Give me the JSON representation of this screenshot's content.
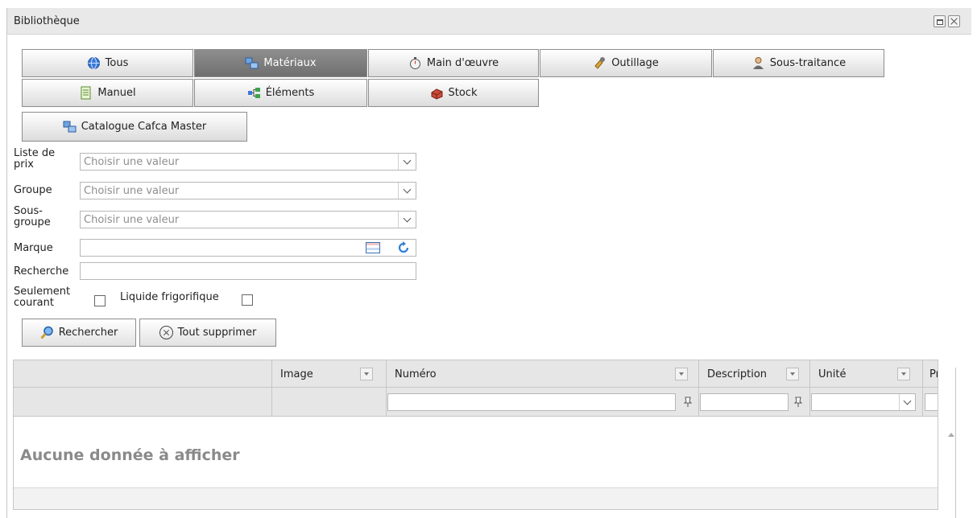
{
  "window": {
    "title": "Bibliothèque"
  },
  "tabs": [
    {
      "label": "Tous",
      "icon": "globe-icon"
    },
    {
      "label": "Matériaux",
      "icon": "materials-icon",
      "active": true
    },
    {
      "label": "Main d'œuvre",
      "icon": "stopwatch-icon"
    },
    {
      "label": "Outillage",
      "icon": "tools-icon"
    },
    {
      "label": "Sous-traitance",
      "icon": "person-icon"
    },
    {
      "label": "Manuel",
      "icon": "manual-icon"
    },
    {
      "label": "Éléments",
      "icon": "elements-icon"
    },
    {
      "label": "Stock",
      "icon": "stock-icon"
    },
    {
      "label": "Catalogue Cafca Master",
      "icon": "catalogue-icon"
    }
  ],
  "filters": {
    "liste_de_prix": {
      "label_line1": "Liste de",
      "label_line2": "prix",
      "placeholder": "Choisir une valeur"
    },
    "groupe": {
      "label": "Groupe",
      "placeholder": "Choisir une valeur"
    },
    "sous_groupe": {
      "label_line1": "Sous-",
      "label_line2": "groupe",
      "placeholder": "Choisir une valeur"
    },
    "marque": {
      "label": "Marque",
      "value": ""
    },
    "recherche": {
      "label": "Recherche",
      "value": ""
    },
    "seulement_courant": {
      "label_line1": "Seulement",
      "label_line2": "courant",
      "checked": false
    },
    "liquide_frigorifique": {
      "label": "Liquide frigorifique",
      "checked": false
    }
  },
  "actions": {
    "search_label": "Rechercher",
    "clear_label": "Tout supprimer"
  },
  "grid": {
    "columns": [
      "",
      "Image",
      "Numéro",
      "Description",
      "Unité",
      "Pri"
    ],
    "empty_text": "Aucune donnée à afficher"
  },
  "colors": {
    "active_tab": "#7a7a7a",
    "empty_text": "#8a8a8a",
    "header_bg": "#e6e6e6"
  }
}
